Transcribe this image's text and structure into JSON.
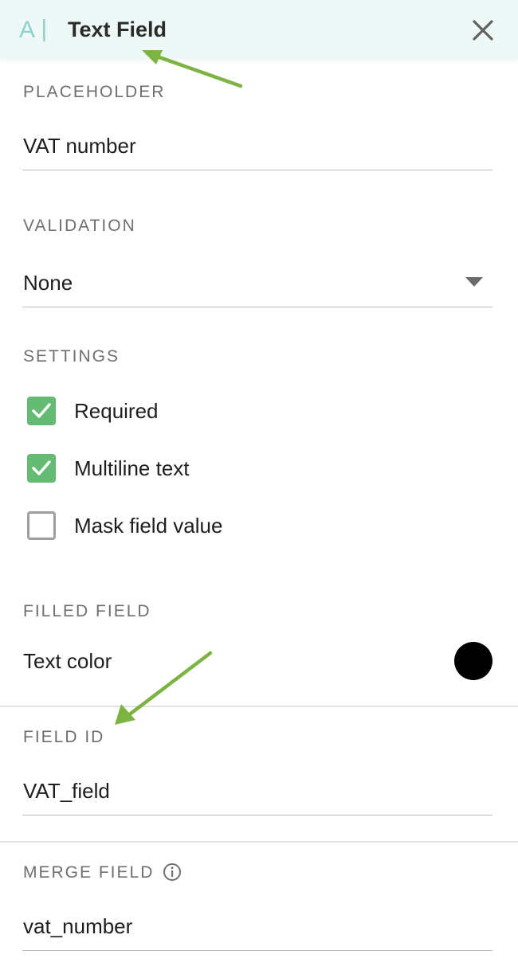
{
  "header": {
    "title": "Text Field",
    "icon": "text-field-icon",
    "close_icon": "close-icon"
  },
  "placeholder": {
    "label": "PLACEHOLDER",
    "value": "VAT number"
  },
  "validation": {
    "label": "VALIDATION",
    "selected": "None"
  },
  "settings": {
    "label": "SETTINGS",
    "items": [
      {
        "label": "Required",
        "checked": true
      },
      {
        "label": "Multiline text",
        "checked": true
      },
      {
        "label": "Mask field value",
        "checked": false
      }
    ]
  },
  "filled_field": {
    "label": "FILLED FIELD",
    "text_color_label": "Text color",
    "text_color": "#000000"
  },
  "field_id": {
    "label": "FIELD ID",
    "value": "VAT_field"
  },
  "merge_field": {
    "label": "MERGE FIELD",
    "value": "vat_number",
    "info_icon": "info-icon"
  },
  "colors": {
    "accent": "#66bb74",
    "header_bg": "#eef8f7",
    "annotation_arrow": "#7cb342"
  }
}
